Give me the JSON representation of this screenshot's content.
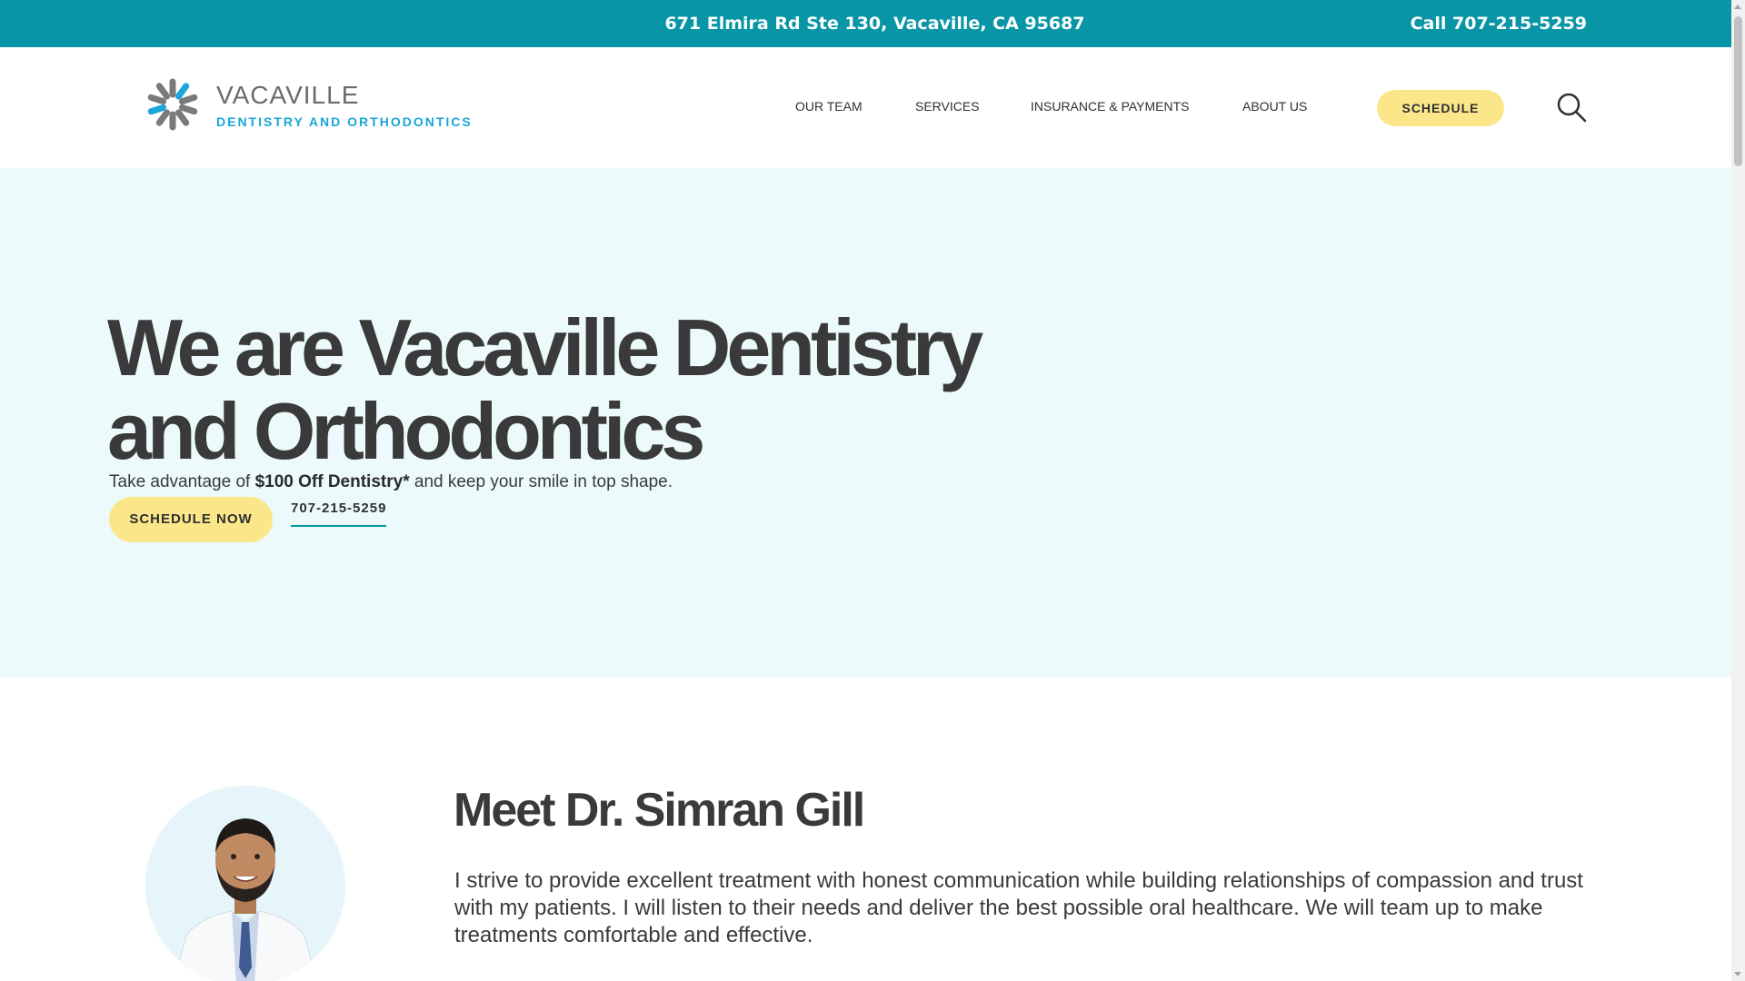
{
  "topbar": {
    "address": "671 Elmira Rd Ste 130, Vacaville, CA 95687",
    "call": "Call 707-215-5259"
  },
  "logo": {
    "name": "VACAVILLE",
    "subtitle": "DENTISTRY AND ORTHODONTICS",
    "colors": {
      "grey": "#7a7a7a",
      "blue": "#1aa6d8"
    }
  },
  "nav": {
    "items": [
      "OUR TEAM",
      "SERVICES",
      "INSURANCE & PAYMENTS",
      "ABOUT US"
    ],
    "schedule_label": "SCHEDULE",
    "search_icon": "search-icon"
  },
  "hero": {
    "title_line1": "We are Vacaville Dentistry",
    "title_line2": "and Orthodontics",
    "tag_prefix": "Take advantage of ",
    "tag_bold": "$100 Off Dentistry*",
    "tag_suffix": " and keep your smile in top shape.",
    "cta_label": "SCHEDULE NOW",
    "phone": "707-215-5259"
  },
  "doctor": {
    "title": "Meet Dr. Simran Gill",
    "body": "I strive to provide excellent treatment with honest communication while building relationships of compassion and trust with my patients. I will listen to their needs and deliver the best possible oral healthcare. We will team up to make treatments comfortable and effective."
  },
  "colors": {
    "topbar": "#0896a6",
    "hero_bg": "#ecfafb",
    "button_yellow": "#fbe78a",
    "accent_blue": "#1aa6d8"
  }
}
